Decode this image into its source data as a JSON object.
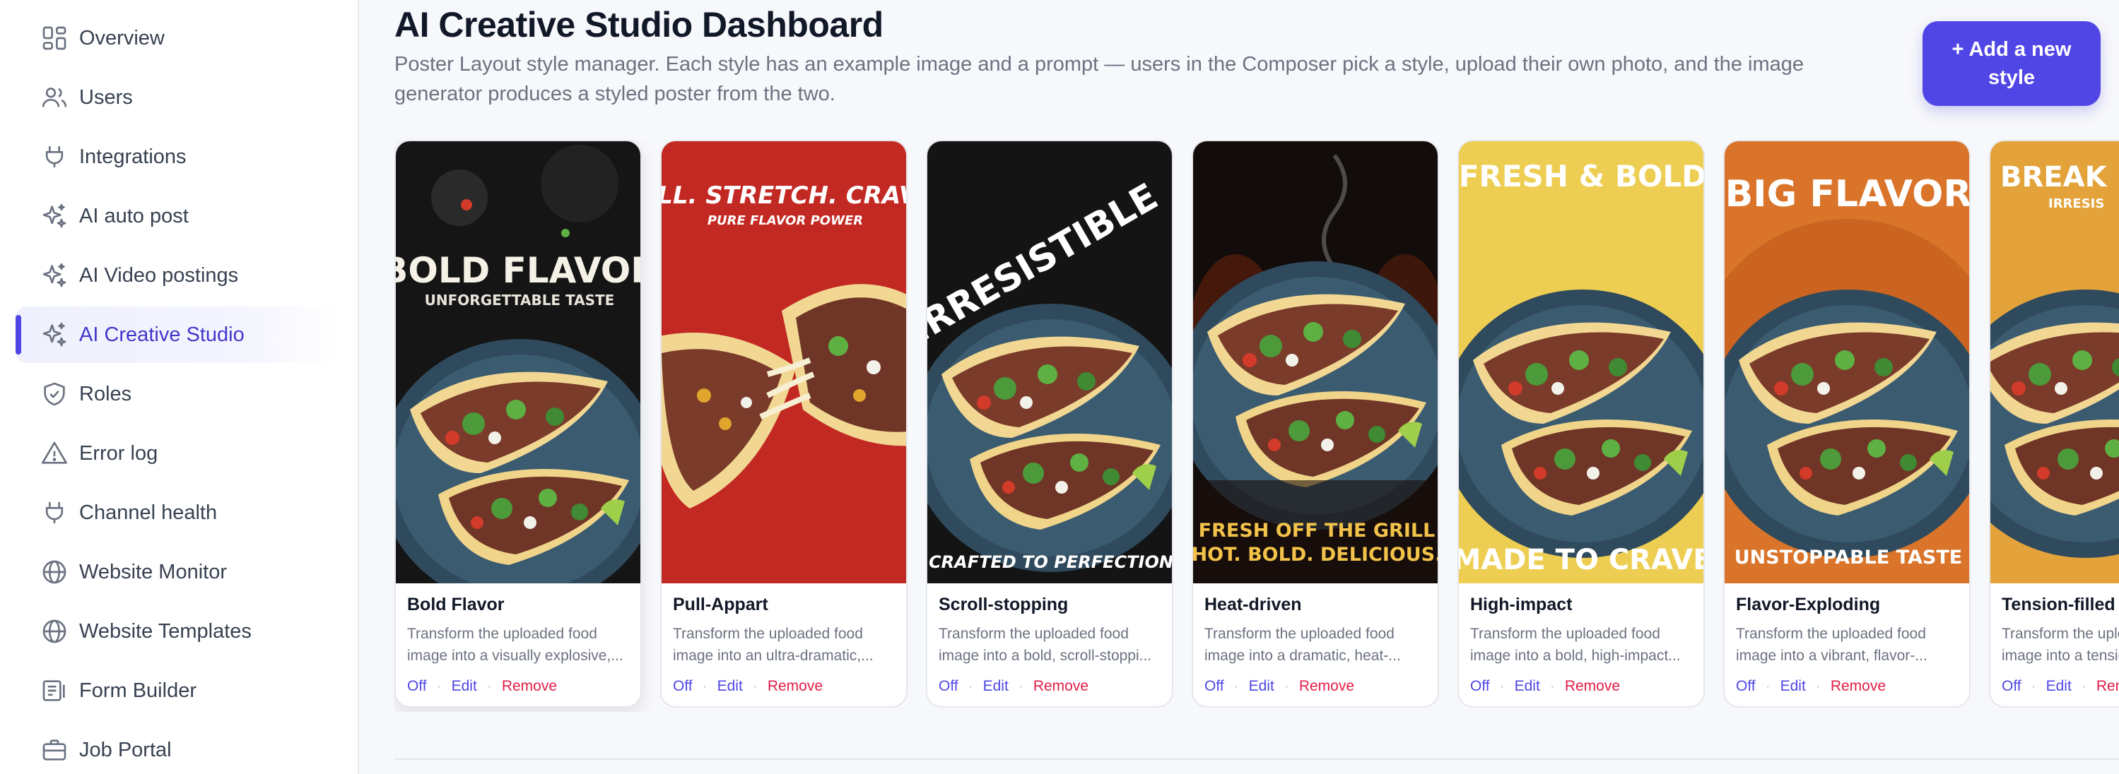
{
  "sidebar": {
    "items": [
      {
        "label": "Overview",
        "icon": "grid-icon"
      },
      {
        "label": "Users",
        "icon": "users-icon"
      },
      {
        "label": "Integrations",
        "icon": "plug-icon"
      },
      {
        "label": "AI auto post",
        "icon": "sparkles-icon"
      },
      {
        "label": "AI Video postings",
        "icon": "sparkles-icon"
      },
      {
        "label": "AI Creative Studio",
        "icon": "sparkles-icon",
        "active": true
      },
      {
        "label": "Roles",
        "icon": "shield-icon"
      },
      {
        "label": "Error log",
        "icon": "warning-icon"
      },
      {
        "label": "Channel health",
        "icon": "plug-icon"
      },
      {
        "label": "Website Monitor",
        "icon": "globe-icon"
      },
      {
        "label": "Website Templates",
        "icon": "globe-icon"
      },
      {
        "label": "Form Builder",
        "icon": "form-icon"
      },
      {
        "label": "Job Portal",
        "icon": "briefcase-icon"
      }
    ]
  },
  "header": {
    "title": "AI Creative Studio Dashboard",
    "subtitle": "Poster Layout style manager. Each style has an example image and a prompt — users in the Composer pick a style, upload their own photo, and the image generator produces a styled poster from the two.",
    "add_button": "+ Add a new style"
  },
  "styles": [
    {
      "name": "Bold Flavor",
      "desc1": "Transform the uploaded food",
      "desc2": "image into a visually explosive,...",
      "poster_top": "BOLD FLAVOR",
      "poster_sub": "UNFORGETTABLE TASTE",
      "poster_bottom": ""
    },
    {
      "name": "Pull-Appart",
      "desc1": "Transform the uploaded food",
      "desc2": "image into an ultra-dramatic,...",
      "poster_top": "PULL. STRETCH. CRAVE.",
      "poster_sub": "PURE FLAVOR POWER",
      "poster_bottom": ""
    },
    {
      "name": "Scroll-stopping",
      "desc1": "Transform the uploaded food",
      "desc2": "image into a bold, scroll-stoppi...",
      "poster_top": "IRRESISTIBLE",
      "poster_sub": "",
      "poster_bottom": "CRAFTED TO PERFECTION"
    },
    {
      "name": "Heat-driven",
      "desc1": "Transform the uploaded food",
      "desc2": "image into a dramatic, heat-...",
      "poster_top": "",
      "poster_sub": "FRESH OFF THE GRILL",
      "poster_bottom": "HOT. BOLD. DELICIOUS."
    },
    {
      "name": "High-impact",
      "desc1": "Transform the uploaded food",
      "desc2": "image into a bold, high-impact...",
      "poster_top": "FRESH & BOLD",
      "poster_sub": "",
      "poster_bottom": "MADE TO CRAVE"
    },
    {
      "name": "Flavor-Exploding",
      "desc1": "Transform the uploaded food",
      "desc2": "image into a vibrant, flavor-...",
      "poster_top": "BIG FLAVOR",
      "poster_sub": "",
      "poster_bottom": "UNSTOPPABLE TASTE"
    },
    {
      "name": "Tension-filled",
      "desc1": "Transform the uploaded food",
      "desc2": "image into a tension-filled...",
      "poster_top": "BREAK IN",
      "poster_sub": "IRRESIS",
      "poster_bottom": ""
    }
  ],
  "actions": {
    "off": "Off",
    "edit": "Edit",
    "remove": "Remove"
  },
  "colors": {
    "accent": "#4f46e5",
    "danger": "#e11d48",
    "muted": "#6b7280"
  }
}
